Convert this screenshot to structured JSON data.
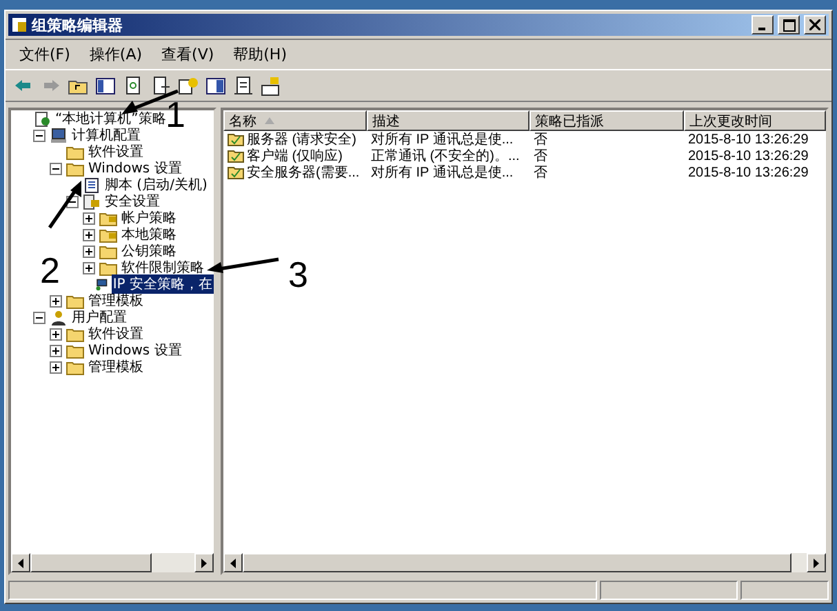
{
  "window": {
    "title": "组策略编辑器"
  },
  "menu": [
    "文件(F)",
    "操作(A)",
    "查看(V)",
    "帮助(H)"
  ],
  "tree": [
    {
      "label": "“本地计算机”策略",
      "kind": "policy",
      "selected": false,
      "children": [
        {
          "label": "计算机配置",
          "kind": "computer",
          "expanded": true,
          "selected": false,
          "children": [
            {
              "label": "软件设置",
              "kind": "folder",
              "selected": false
            },
            {
              "label": "Windows 设置",
              "kind": "folder",
              "expanded": true,
              "selected": false,
              "children": [
                {
                  "label": "脚本 (启动/关机)",
                  "kind": "script",
                  "selected": false
                },
                {
                  "label": "安全设置",
                  "kind": "security",
                  "expanded": true,
                  "selected": false,
                  "children": [
                    {
                      "label": "帐户策略",
                      "kind": "lockfolder",
                      "expanded": false,
                      "selected": false
                    },
                    {
                      "label": "本地策略",
                      "kind": "lockfolder",
                      "expanded": false,
                      "selected": false
                    },
                    {
                      "label": "公钥策略",
                      "kind": "folder",
                      "expanded": false,
                      "selected": false
                    },
                    {
                      "label": "软件限制策略",
                      "kind": "folder",
                      "expanded": false,
                      "selected": false
                    },
                    {
                      "label": "IP 安全策略，在",
                      "kind": "network",
                      "selected": true
                    }
                  ]
                }
              ]
            },
            {
              "label": "管理模板",
              "kind": "folder",
              "expanded": false,
              "selected": false
            }
          ]
        },
        {
          "label": "用户配置",
          "kind": "user",
          "expanded": true,
          "selected": false,
          "children": [
            {
              "label": "软件设置",
              "kind": "folder",
              "expanded": false,
              "selected": false
            },
            {
              "label": "Windows 设置",
              "kind": "folder",
              "expanded": false,
              "selected": false
            },
            {
              "label": "管理模板",
              "kind": "folder",
              "expanded": false,
              "selected": false
            }
          ]
        }
      ]
    }
  ],
  "table": {
    "columns": [
      "名称",
      "描述",
      "策略已指派",
      "上次更改时间"
    ],
    "rows": [
      [
        "服务器 (请求安全)",
        "对所有 IP 通讯总是使...",
        "否",
        "2015-8-10 13:26:29"
      ],
      [
        "客户端 (仅响应)",
        "正常通讯 (不安全的)。...",
        "否",
        "2015-8-10 13:26:29"
      ],
      [
        "安全服务器(需要...",
        "对所有 IP 通讯总是使...",
        "否",
        "2015-8-10 13:26:29"
      ]
    ]
  },
  "annotations": [
    "1",
    "2",
    "3"
  ]
}
